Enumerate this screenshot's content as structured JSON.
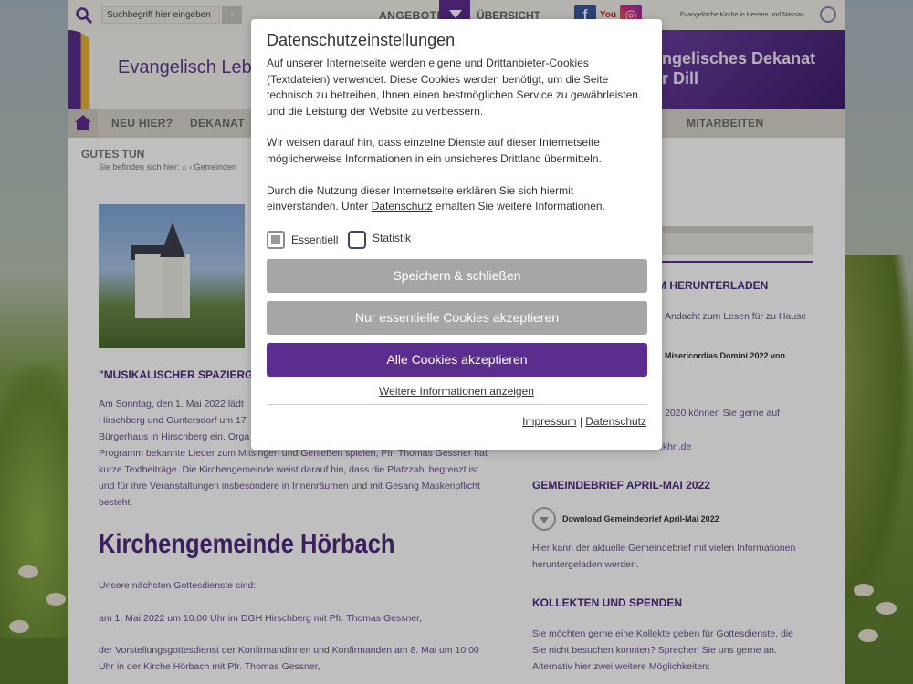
{
  "topbar": {
    "search_placeholder": "Suchbegriff hier eingeben",
    "search_button": "›",
    "angebote": "ANGEBOTE",
    "uebersicht": "ÜBERSICHT",
    "social": {
      "facebook": "f",
      "youtube": "You",
      "instagram": "◎"
    },
    "ekhn": "Evangelische Kirche in Hessen und Nassau"
  },
  "header": {
    "logo_text": "Evangelisch Leb",
    "right_title_line1": "ngelisches Dekanat",
    "right_title_line2": "r Dill"
  },
  "nav": {
    "items": [
      "NEU HIER?",
      "DEKANAT",
      "MITARBEITEN"
    ]
  },
  "breadcrumb": {
    "title": "GUTES TUN",
    "prefix": "Sie befinden sich hier:",
    "path": "Gemeinden"
  },
  "article": {
    "title": "\"MUSIKALISCHER SPAZIERGANG",
    "para_lines": [
      "Am Sonntag, den 1. Mai 2022 lädt",
      "Hirschberg und Guntersdorf um 17",
      "Bürgerhaus in Hirschberg ein. Orga",
      "Programm bekannte Lieder zum Mitsingen und Genießen spielen, Pfr. Thomas Gessner hat",
      "kurze Textbeiträge. Die Kirchengemeinde weist darauf hin, dass die Platzzahl begrenzt ist",
      "und für ihre Veranstaltungen insbesondere in Innenräumen und mit Gesang Maskenpflicht",
      "besteht."
    ],
    "h1": "Kirchengemeinde Hörbach",
    "next": "Unsere nächsten Gottesdienste sind:",
    "gd1": "am 1. Mai 2022 um 10.00 Uhr im DGH Hirschberg mit Pfr. Thomas Gessner,",
    "gd2_line1": "der Vorstellungsgottesdienst der Konfirmandinnen und Konfirmanden am 8. Mai um 10.00",
    "gd2_line2": "Uhr in der Kirche Hörbach mit Pfr. Thomas Gessner,"
  },
  "sidebar": {
    "h_download": "M HERUNTERLADEN",
    "t_andacht": "Andacht zum Lesen für zu Hause",
    "b_misericordias": "Misericordias Domini 2022 von",
    "t_2020": "2020 können Sie gerne auf",
    "t_ekhn": "ekhn.de",
    "h_gemeindebrief": "GEMEINDEBRIEF APRIL-MAI 2022",
    "b_download_gb": "Download Gemeindebrief April-Mai 2022",
    "t_gb_line1": "Hier kann der aktuelle Gemeindebrief mit vielen Informationen",
    "t_gb_line2": "heruntergeladen werden.",
    "h_kollekten": "KOLLEKTEN UND SPENDEN",
    "t_k_line1": "Sie möchten gerne eine Kollekte geben für Gottesdienste, die",
    "t_k_line2": "Sie nicht besuchen konnten? Sprechen Sie uns gerne an.",
    "t_k_line3": "Alternativ hier zwei weitere Möglichkeiten:"
  },
  "modal": {
    "title": "Datenschutzeinstellungen",
    "p1": "Auf unserer Internetseite werden eigene und Drittanbieter-Cookies (Textdateien) verwendet. Diese Cookies werden benötigt, um die Seite technisch zu betreiben, Ihnen einen bestmöglichen Service zu gewährleisten und die Leistung der Website zu verbessern.",
    "p2": "Wir weisen darauf hin, dass einzelne Dienste auf dieser Internetseite möglicherweise Informationen in ein unsicheres Drittland übermitteln.",
    "p3_a": "Durch die Nutzung dieser Internetseite erklären Sie sich hiermit einverstanden. Unter ",
    "p3_link": "Datenschutz",
    "p3_b": " erhalten Sie weitere Informationen.",
    "check_essentiell": "Essentiell",
    "check_statistik": "Statistik",
    "btn_save": "Speichern & schließen",
    "btn_essential": "Nur essentielle Cookies akzeptieren",
    "btn_all": "Alle Cookies akzeptieren",
    "more_info": "Weitere Informationen anzeigen",
    "footer_impressum": "Impressum",
    "footer_sep": "|",
    "footer_datenschutz": "Datenschutz"
  },
  "colors": {
    "accent": "#5b2d8e",
    "button_gray": "#a6a6a6"
  }
}
